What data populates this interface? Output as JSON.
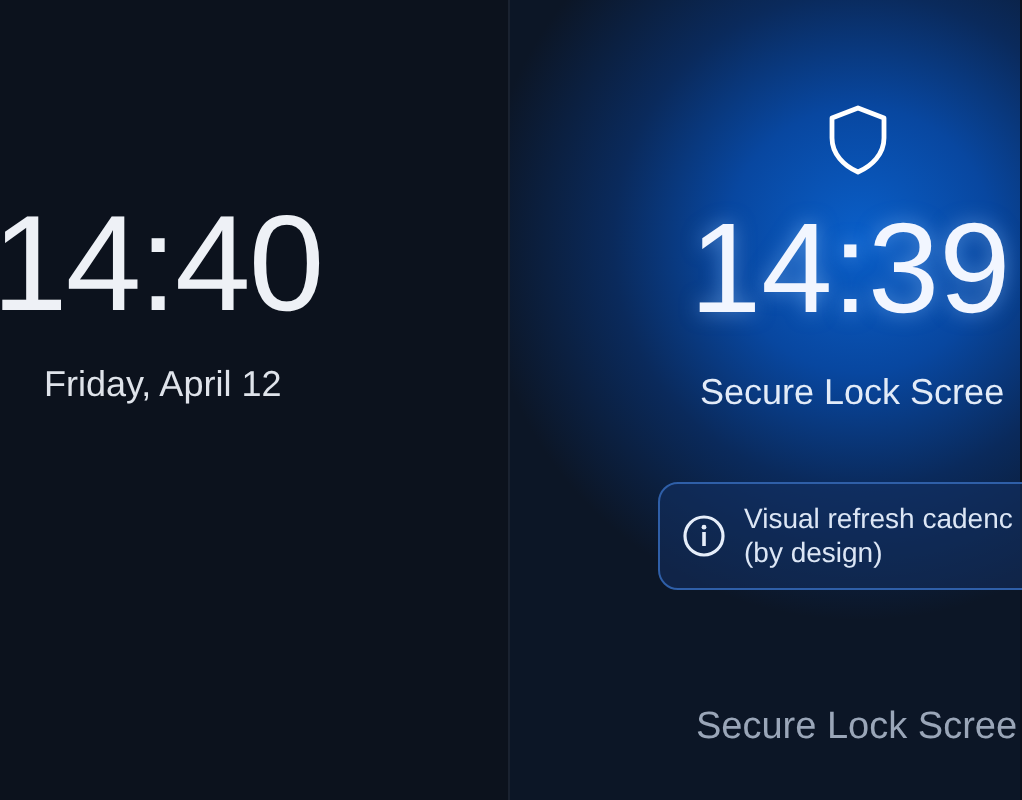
{
  "panels": [
    {
      "kind": "standard",
      "time": "14:40",
      "date": "Friday, April 12"
    },
    {
      "kind": "secure",
      "time": "14:39",
      "subtitle": "Secure Lock Scree",
      "notice": {
        "lines": [
          "Visual refresh cadenc",
          "(by design)"
        ]
      },
      "footer": "Secure Lock Scree"
    }
  ]
}
